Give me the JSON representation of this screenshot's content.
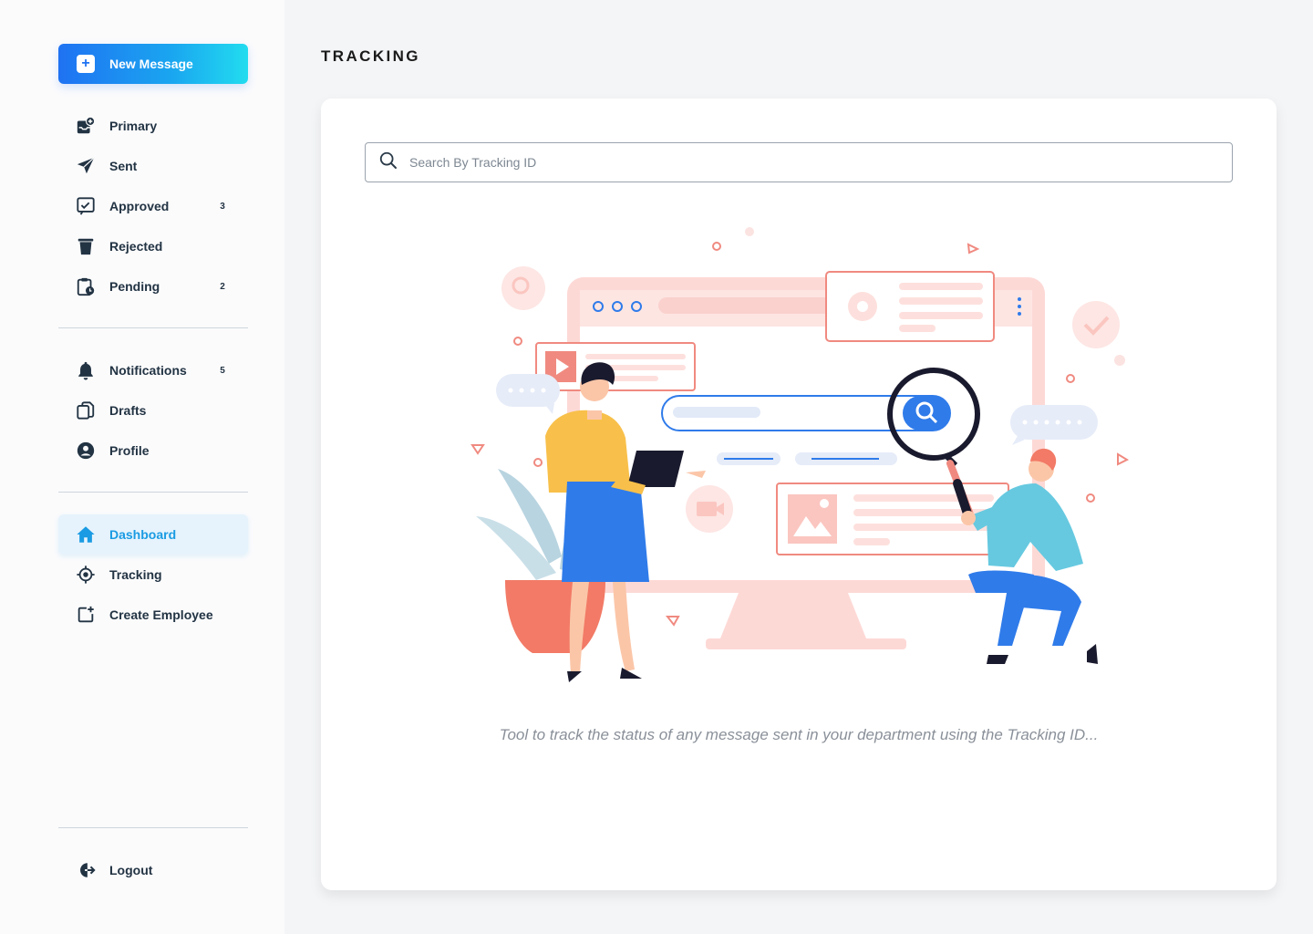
{
  "sidebar": {
    "new_message_label": "New Message",
    "mail_items": [
      {
        "label": "Primary",
        "badge": "",
        "icon": "inbox-plus-icon"
      },
      {
        "label": "Sent",
        "badge": "",
        "icon": "paper-plane-icon"
      },
      {
        "label": "Approved",
        "badge": "3",
        "icon": "checkbox-icon"
      },
      {
        "label": "Rejected",
        "badge": "",
        "icon": "trash-icon"
      },
      {
        "label": "Pending",
        "badge": "2",
        "icon": "clipboard-clock-icon"
      }
    ],
    "account_items": [
      {
        "label": "Notifications",
        "badge": "5",
        "icon": "bell-icon"
      },
      {
        "label": "Drafts",
        "badge": "",
        "icon": "copy-icon"
      },
      {
        "label": "Profile",
        "badge": "",
        "icon": "user-circle-icon"
      }
    ],
    "admin_items": [
      {
        "label": "Dashboard",
        "active": true,
        "icon": "home-icon"
      },
      {
        "label": "Tracking",
        "active": false,
        "icon": "crosshair-icon"
      },
      {
        "label": "Create Employee",
        "active": false,
        "icon": "add-box-icon"
      }
    ],
    "logout_label": "Logout"
  },
  "main": {
    "title": "TRACKING",
    "search_placeholder": "Search By Tracking ID",
    "caption": "Tool to track the status of any message sent in your department using the Tracking ID..."
  },
  "colors": {
    "accent": "#1a9be3",
    "primary_gradient_start": "#1f72f2",
    "primary_gradient_end": "#22dcef",
    "text_dark": "#223343",
    "illustration_pink": "#f5a7a3",
    "illustration_blue": "#2f7bea"
  }
}
